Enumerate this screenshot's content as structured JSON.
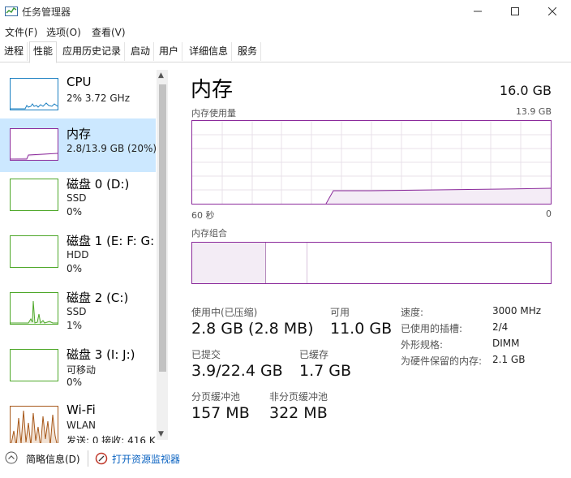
{
  "window": {
    "title": "任务管理器"
  },
  "menu": [
    "文件(F)",
    "选项(O)",
    "查看(V)"
  ],
  "tabs": [
    "进程",
    "性能",
    "应用历史记录",
    "启动",
    "用户",
    "详细信息",
    "服务"
  ],
  "sidebar": {
    "items": [
      {
        "title": "CPU",
        "sub1": "2%  3.72 GHz"
      },
      {
        "title": "内存",
        "sub1": "2.8/13.9 GB (20%)"
      },
      {
        "title": "磁盘 0 (D:)",
        "sub1": "SSD",
        "sub2": "0%"
      },
      {
        "title": "磁盘 1 (E: F: G:",
        "sub1": "HDD",
        "sub2": "0%"
      },
      {
        "title": "磁盘 2 (C:)",
        "sub1": "SSD",
        "sub2": "1%"
      },
      {
        "title": "磁盘 3 (I: J:)",
        "sub1": "可移动",
        "sub2": "0%"
      },
      {
        "title": "Wi-Fi",
        "sub1": "WLAN",
        "sub2": "发送: 0  接收: 416 K"
      }
    ]
  },
  "main": {
    "title": "内存",
    "total": "16.0 GB",
    "usage_label": "内存使用量",
    "usage_max": "13.9 GB",
    "axis_left": "60 秒",
    "axis_right": "0",
    "composition_label": "内存组合",
    "stats": {
      "in_use_label": "使用中(已压缩)",
      "in_use_value": "2.8 GB (2.8 MB)",
      "available_label": "可用",
      "available_value": "11.0 GB",
      "committed_label": "已提交",
      "committed_value": "3.9/22.4 GB",
      "cached_label": "已缓存",
      "cached_value": "1.7 GB",
      "paged_label": "分页缓冲池",
      "paged_value": "157 MB",
      "nonpaged_label": "非分页缓冲池",
      "nonpaged_value": "322 MB"
    },
    "details": [
      {
        "label": "速度:",
        "value": "3000 MHz"
      },
      {
        "label": "已使用的插槽:",
        "value": "2/4"
      },
      {
        "label": "外形规格:",
        "value": "DIMM"
      },
      {
        "label": "为硬件保留的内存:",
        "value": "2.1 GB"
      }
    ]
  },
  "footer": {
    "brief": "简略信息(D)",
    "resmon": "打开资源监视器"
  },
  "colors": {
    "memory": "#8b2a9b",
    "cpu": "#1a7fc1",
    "disk": "#4da728",
    "wifi": "#a7581a",
    "selected": "#cce8ff"
  }
}
